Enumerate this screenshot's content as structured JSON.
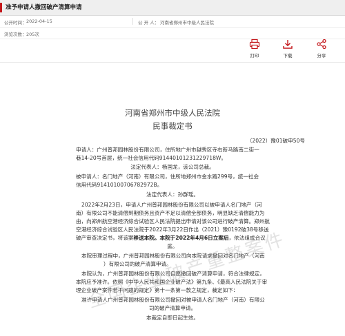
{
  "header": {
    "title": "准予申请人撤回破产清算申请",
    "publish_label": "公开时间：",
    "publish_date": "2022-04-15",
    "publisher_label": "公 开 人：",
    "publisher": "河南省郑州市中级人民法院",
    "views_label": "浏览次数：",
    "views": "205次"
  },
  "actions": [
    {
      "label": "打印",
      "icon": "print-icon"
    },
    {
      "label": "下载",
      "icon": "download-icon"
    },
    {
      "label": "分享",
      "icon": "share-icon"
    }
  ],
  "colors": {
    "accent": "#c4171b"
  },
  "watermark": "全国企业破产重整案件",
  "document": {
    "court": "河南省郑州市中级人民法院",
    "type": "民事裁定书",
    "case_number": "（2022）豫01破申50号",
    "applicant_line1": "申请人：广州普邦园林股份有限公司，住所地广州市越秀区寺右新马路南二街一",
    "applicant_line2": "巷14-20号首层，统一社会信用代码91440101231229718W。",
    "applicant_rep": "法定代表人：杨国龙，该公司总裁。",
    "respondent_line1": "被申请人：名门地产（河南）有限公司，住所地郑州市金水路299号，统一社会",
    "respondent_line2": "信用代码914101007067829​72B。",
    "respondent_rep": "法定代表人：孙群瑶。",
    "facts_1": "2022年2月23日，申请人广州普邦园林股份有限公司以被申请人名门地产（河",
    "facts_2": "南）有限公司不能清偿到期债务且资产不足以清偿全部债务，明显缺乏清偿能力为",
    "facts_3": "由，向郑州航空港经济综合试验区人民法院提出申请对该公司进行破产清算。郑州航",
    "facts_4": "空港经济综合试验区人民法院于2022年3月22日作出（2021）豫0192破38号移送",
    "facts_5a": "破产审查决定书，将该案",
    "facts_5b": "移送本院",
    "facts_5c": "。本院于2022年4月6日立案后",
    "facts_5d": "，依法组成合议",
    "facts_6": "庭。",
    "process_1": "本院审理过程中，广州普邦园林股份有限公司向本院请求撤回对名门地产（河南",
    "process_2": "）有限公司的破产清算申请。",
    "reason_1": "本院认为，广州普邦园林股份有限公司自愿撤回破产清算申请，符合法律规定，",
    "reason_2": "本院应予准许。依照《中华人民共和国企业破产法》第九条、《最高人民法院关于审",
    "reason_3": "理企业破产案件若干问题的规定》第十一条第一款之规定，裁定如下：",
    "ruling_1": "准许申请人广州普邦园林股份有限公司撤回对被申请人名门地产（河南）有限公",
    "ruling_2": "司的破产清算申请。",
    "effect": "本裁定自即日起生效。"
  }
}
